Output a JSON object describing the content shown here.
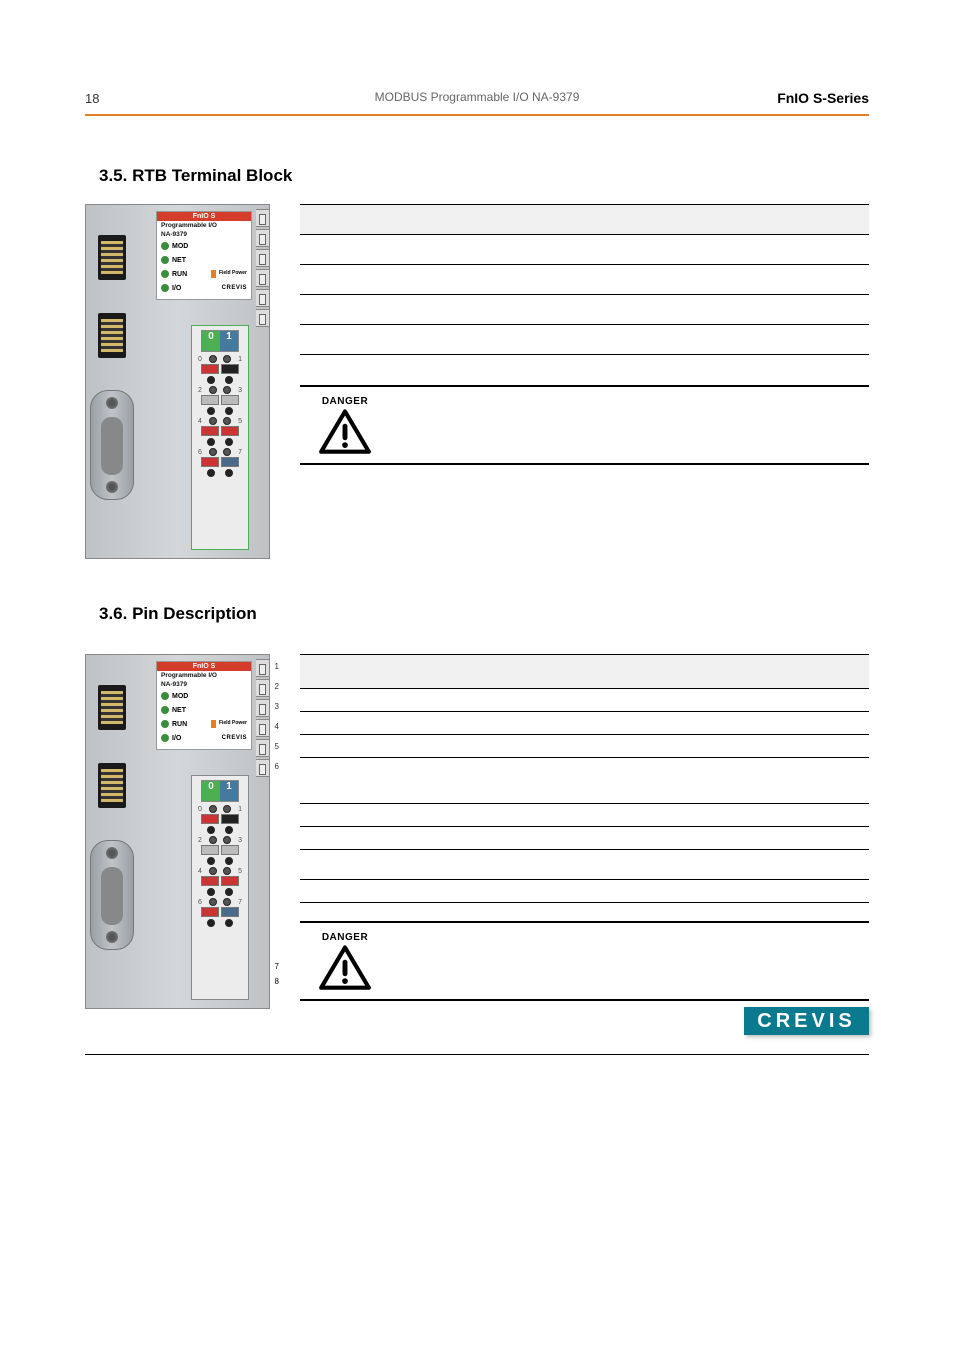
{
  "header": {
    "page_number": "18",
    "center": "MODBUS Programmable I/O NA-9379",
    "right": "FnIO  S-Series"
  },
  "section35": {
    "title": "3.5. RTB Terminal Block"
  },
  "section36": {
    "title": "3.6. Pin Description"
  },
  "module_label": {
    "brand": "FnIO S",
    "line1": "Programmable I/O",
    "line2": "NA-9379",
    "led_mod": "MOD",
    "led_net": "NET",
    "led_run": "RUN",
    "field_power": "Field Power",
    "led_io": "I/O",
    "crevis": "CREVIS"
  },
  "rtb": {
    "top_left": "0",
    "top_right": "1"
  },
  "clips": {
    "n1": "1",
    "n2": "2",
    "n3": "3",
    "n4": "4",
    "n5": "5",
    "n6": "6",
    "n7": "7",
    "n8": "8"
  },
  "danger": {
    "label": "DANGER"
  },
  "logo": "CREVIS"
}
